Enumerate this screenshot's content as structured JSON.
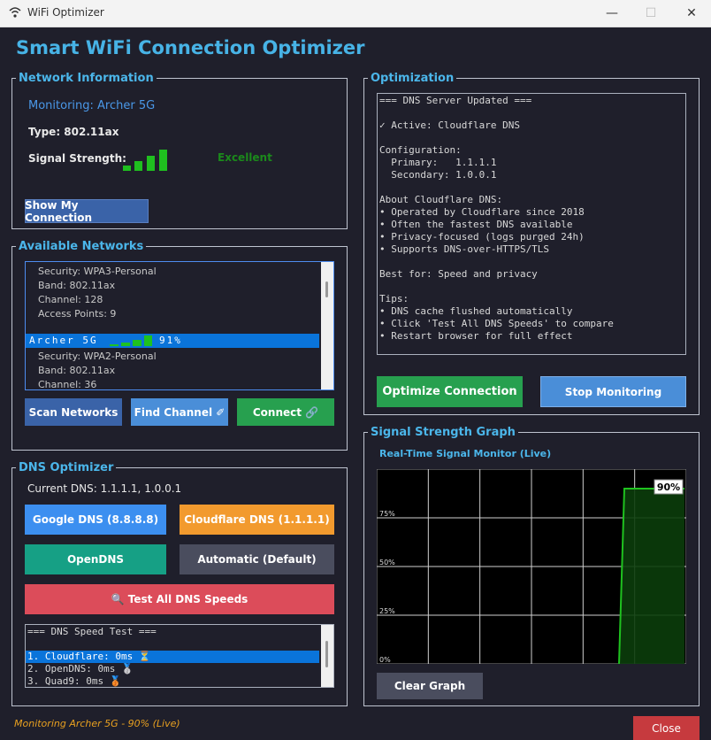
{
  "window": {
    "title": "WiFi Optimizer",
    "minimize": "—",
    "maximize": "☐",
    "close": "✕"
  },
  "app_title": "Smart WiFi Connection Optimizer",
  "network_info": {
    "legend": "Network Information",
    "monitoring": "Monitoring: Archer 5G",
    "type": "Type: 802.11ax",
    "signal_label": "Signal Strength:",
    "signal_quality": "Excellent",
    "signal_level_bars": 4,
    "show_button": "Show My Connection"
  },
  "available_networks": {
    "legend": "Available Networks",
    "lines": [
      "Security: WPA3-Personal",
      "Band: 802.11ax",
      "Channel: 128",
      "Access Points: 9"
    ],
    "selected_name": "Archer 5G",
    "selected_percent": "91%",
    "lines_after": [
      "Security: WPA2-Personal",
      "Band: 802.11ax",
      "Channel: 36"
    ],
    "buttons": {
      "scan": "Scan Networks",
      "find": "Find Channel ✐",
      "connect": "Connect 🔗"
    }
  },
  "dns_optimizer": {
    "legend": "DNS Optimizer",
    "current_dns": "Current DNS: 1.1.1.1, 1.0.0.1",
    "buttons": {
      "google": "Google DNS (8.8.8.8)",
      "cloudflare": "Cloudflare DNS (1.1.1.1)",
      "opendns": "OpenDNS",
      "automatic": "Automatic (Default)",
      "test_all": "🔍 Test All DNS Speeds"
    },
    "results": {
      "header": "=== DNS Speed Test ===",
      "items": [
        "1. Cloudflare: 0ms ⏳",
        "2. OpenDNS: 0ms 🥈",
        "3. Quad9: 0ms 🥉"
      ]
    }
  },
  "optimization": {
    "legend": "Optimization",
    "log": "=== DNS Server Updated ===\n\n✓ Active: Cloudflare DNS\n\nConfiguration:\n  Primary:   1.1.1.1\n  Secondary: 1.0.0.1\n\nAbout Cloudflare DNS:\n• Operated by Cloudflare since 2018\n• Often the fastest DNS available\n• Privacy-focused (logs purged 24h)\n• Supports DNS-over-HTTPS/TLS\n\nBest for: Speed and privacy\n\nTips:\n• DNS cache flushed automatically\n• Click 'Test All DNS Speeds' to compare\n• Restart browser for full effect",
    "optimize_button": "Optimize Connection",
    "stop_button": "Stop Monitoring"
  },
  "signal_graph": {
    "legend": "Signal Strength Graph",
    "subtitle": "Real-Time Signal Monitor (Live)",
    "clear_button": "Clear Graph",
    "chart_data": {
      "type": "line",
      "ylim": [
        0,
        100
      ],
      "y_tick_labels": [
        "75%",
        "50%",
        "25%",
        "0%"
      ],
      "y_ticks": [
        75,
        50,
        25,
        0
      ],
      "series": [
        {
          "values": [
            0,
            90,
            90,
            90,
            90
          ]
        }
      ],
      "current_label": "90%",
      "colors": {
        "line": "#1fc21f",
        "fill": "#0b3d0b",
        "grid": "#cfcfcf",
        "bg": "#000000"
      }
    }
  },
  "status_text": "Monitoring Archer 5G - 90% (Live)",
  "close_button": "Close",
  "colors": {
    "accent": "#47b3e6",
    "google": "#3c8ff0",
    "cloudflare": "#f29a2e",
    "opendns": "#16a085",
    "automatic": "#4a4d5e",
    "test": "#dc4c5a",
    "optimize": "#27a04f",
    "stop": "#4a8ed8",
    "close": "#c63a3e"
  }
}
